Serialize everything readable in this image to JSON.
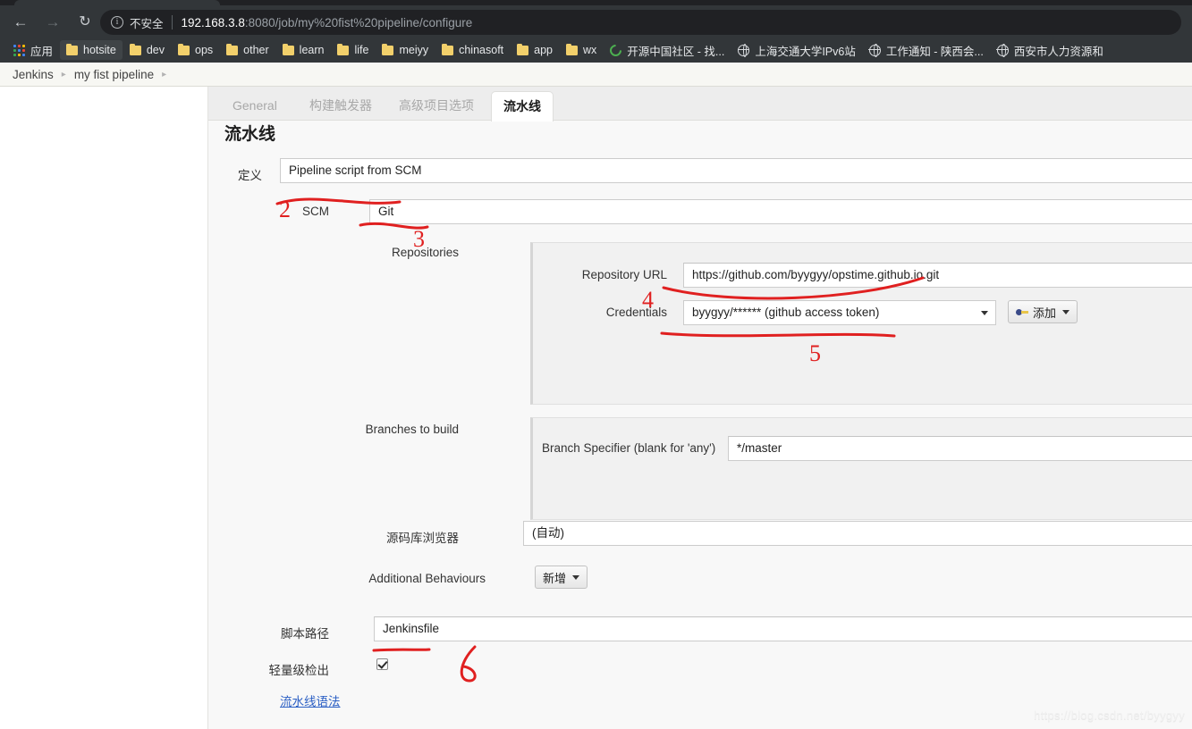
{
  "browser": {
    "back_icon": "back-arrow-icon",
    "forward_icon": "forward-arrow-icon",
    "reload_icon": "reload-icon",
    "security_label": "不安全",
    "url_host": "192.168.3.8",
    "url_path": ":8080/job/my%20fist%20pipeline/configure",
    "url_full": "192.168.3.8:8080/job/my%20fist%20pipeline/configure"
  },
  "bookmarks": [
    {
      "label": "应用",
      "icon": "apps-grid-icon"
    },
    {
      "label": "hotsite",
      "icon": "folder-icon"
    },
    {
      "label": "dev",
      "icon": "folder-icon"
    },
    {
      "label": "ops",
      "icon": "folder-icon"
    },
    {
      "label": "other",
      "icon": "folder-icon"
    },
    {
      "label": "learn",
      "icon": "folder-icon"
    },
    {
      "label": "life",
      "icon": "folder-icon"
    },
    {
      "label": "meiyy",
      "icon": "folder-icon"
    },
    {
      "label": "chinasoft",
      "icon": "folder-icon"
    },
    {
      "label": "app",
      "icon": "folder-icon"
    },
    {
      "label": "wx",
      "icon": "folder-icon"
    },
    {
      "label": "开源中国社区 - 找...",
      "icon": "oschina-icon"
    },
    {
      "label": "上海交通大学IPv6站",
      "icon": "globe-icon"
    },
    {
      "label": "工作通知 - 陕西会...",
      "icon": "globe-icon"
    },
    {
      "label": "西安市人力资源和",
      "icon": "globe-icon"
    }
  ],
  "breadcrumb": {
    "items": [
      "Jenkins",
      "my fist pipeline"
    ],
    "separator": "▸"
  },
  "tabs": [
    {
      "label": "General",
      "active": false
    },
    {
      "label": "构建触发器",
      "active": false
    },
    {
      "label": "高级项目选项",
      "active": false
    },
    {
      "label": "流水线",
      "active": true
    }
  ],
  "form": {
    "title": "流水线",
    "definition_label": "定义",
    "definition_value": "Pipeline script from SCM",
    "scm_label": "SCM",
    "scm_value": "Git",
    "repositories_label": "Repositories",
    "repository_url_label": "Repository URL",
    "repository_url_value": "https://github.com/byygyy/opstime.github.io.git",
    "credentials_label": "Credentials",
    "credentials_value": "byygyy/****** (github access token)",
    "add_button_label": "添加",
    "add_button_icon": "key-icon",
    "branches_label": "Branches to build",
    "branch_specifier_label": "Branch Specifier (blank for 'any')",
    "branch_specifier_value": "*/master",
    "repo_browser_label": "源码库浏览器",
    "repo_browser_value": "(自动)",
    "additional_behaviours_label": "Additional Behaviours",
    "additional_behaviours_button": "新增",
    "script_path_label": "脚本路径",
    "script_path_value": "Jenkinsfile",
    "lightweight_checkout_label": "轻量级检出",
    "lightweight_checkout_checked": true,
    "pipeline_syntax_link": "流水线语法"
  },
  "annotations": {
    "numbers": [
      "2",
      "3",
      "4",
      "5",
      "6"
    ],
    "color": "#e02020"
  },
  "watermark": "https://blog.csdn.net/byygyy",
  "colors": {
    "chrome_bg": "#323639",
    "omnibox_bg": "#202124",
    "content_bg": "#f8f8f8",
    "panel_bg": "#f1f1f1",
    "link": "#2b5fc4",
    "annotation_red": "#e02020"
  }
}
